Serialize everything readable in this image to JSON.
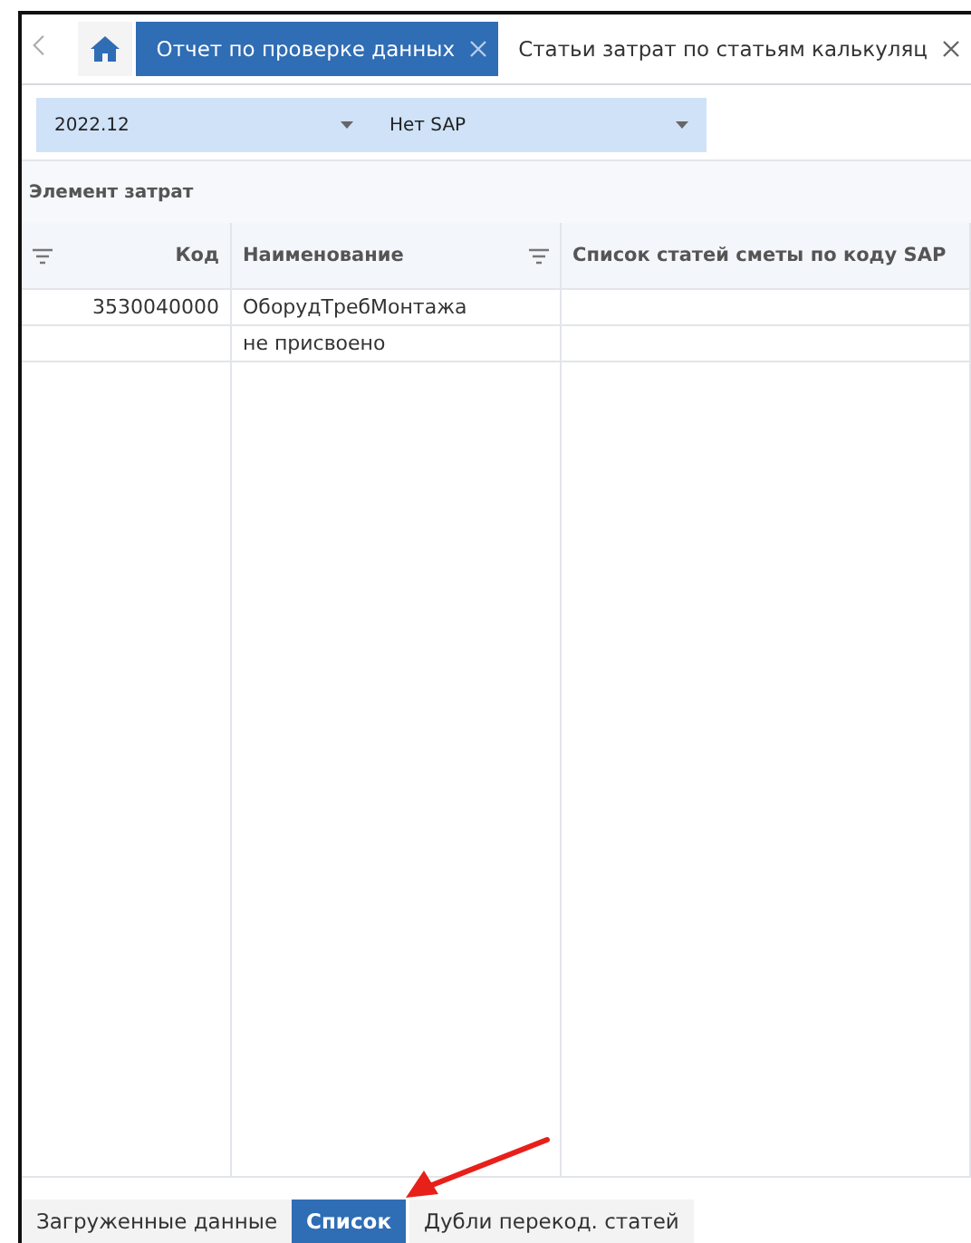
{
  "tabs": [
    {
      "label": "Отчет по проверке данных",
      "selected": true
    },
    {
      "label": "Статьи затрат по статьям калькуляц",
      "selected": false
    }
  ],
  "filters": [
    {
      "value": "2022.12"
    },
    {
      "value": "Нет SAP"
    }
  ],
  "section_title": "Элемент затрат",
  "table": {
    "columns": [
      {
        "label": "Код",
        "filter": true
      },
      {
        "label": "Наименование",
        "filter": true
      },
      {
        "label": "Список статей сметы по коду SAP",
        "filter": false
      }
    ],
    "rows": [
      [
        "3530040000",
        "ОборудТребМонтажа",
        ""
      ],
      [
        "",
        "не присвоено",
        ""
      ]
    ]
  },
  "bottom_tabs": [
    {
      "label": "Загруженные данные",
      "selected": false
    },
    {
      "label": "Список",
      "selected": true
    },
    {
      "label": "Дубли перекод. статей",
      "selected": false
    }
  ]
}
